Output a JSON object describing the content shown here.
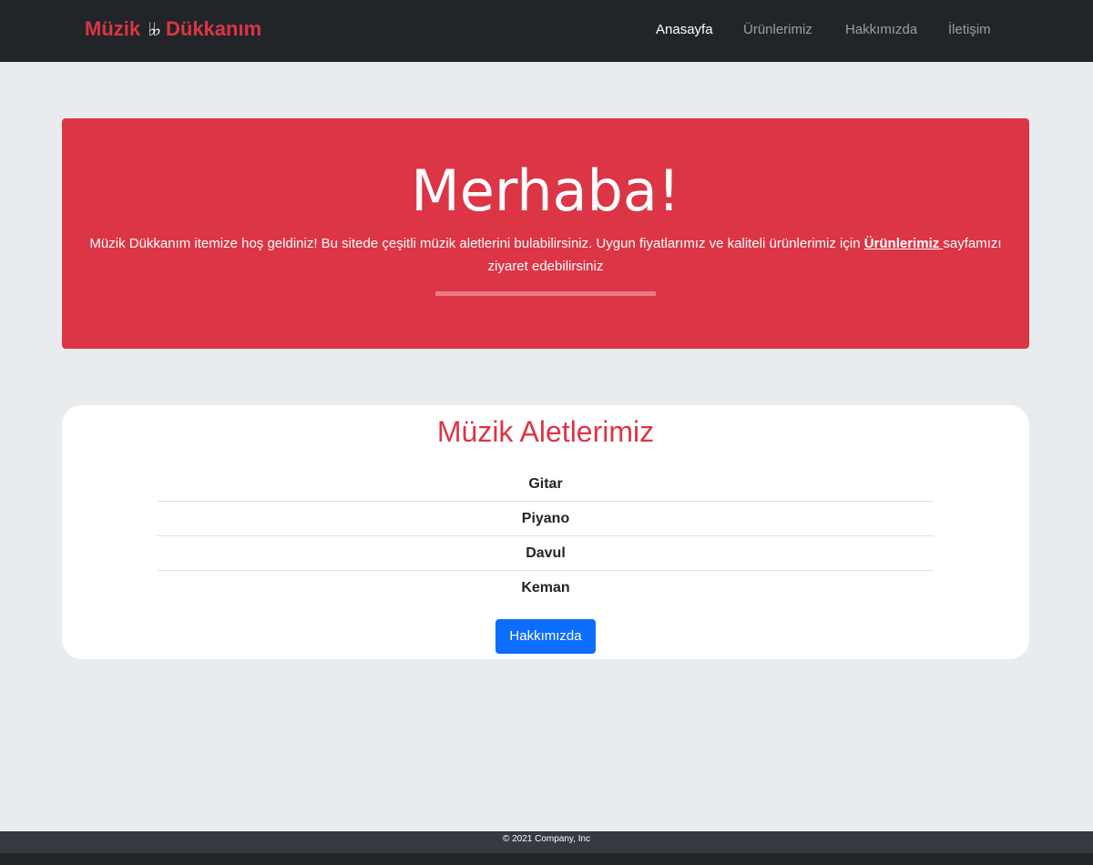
{
  "navbar": {
    "brand_left": "Müzik",
    "brand_icon": "music-notes-icon",
    "brand_icon_glyph": "♭♭",
    "brand_right": "Dükkanım",
    "links": [
      {
        "label": "Anasayfa",
        "active": true
      },
      {
        "label": "Ürünlerimiz",
        "active": false
      },
      {
        "label": "Hakkımızda",
        "active": false
      },
      {
        "label": "İletişim",
        "active": false
      }
    ]
  },
  "hero": {
    "title": "Merhaba!",
    "text_before": "Müzik Dükkanım itemize hoş geldiniz! Bu sitede çeşitli müzik aletlerini bulabilirsiniz. Uygun fiyatlarımız ve kaliteli ürünlerimiz için ",
    "link_label": "Ürünlerimiz ",
    "text_after": "sayfamızı ziyaret edebilirsiniz"
  },
  "instruments": {
    "title": "Müzik Aletlerimiz",
    "items": [
      "Gitar",
      "Piyano",
      "Davul",
      "Keman"
    ],
    "button_label": "Hakkımızda"
  },
  "footer": {
    "text": "© 2021 Company, Inc"
  },
  "colors": {
    "accent": "#dc3545",
    "navbar": "#212529",
    "background": "#e9ecef",
    "button": "#0d6efd"
  }
}
